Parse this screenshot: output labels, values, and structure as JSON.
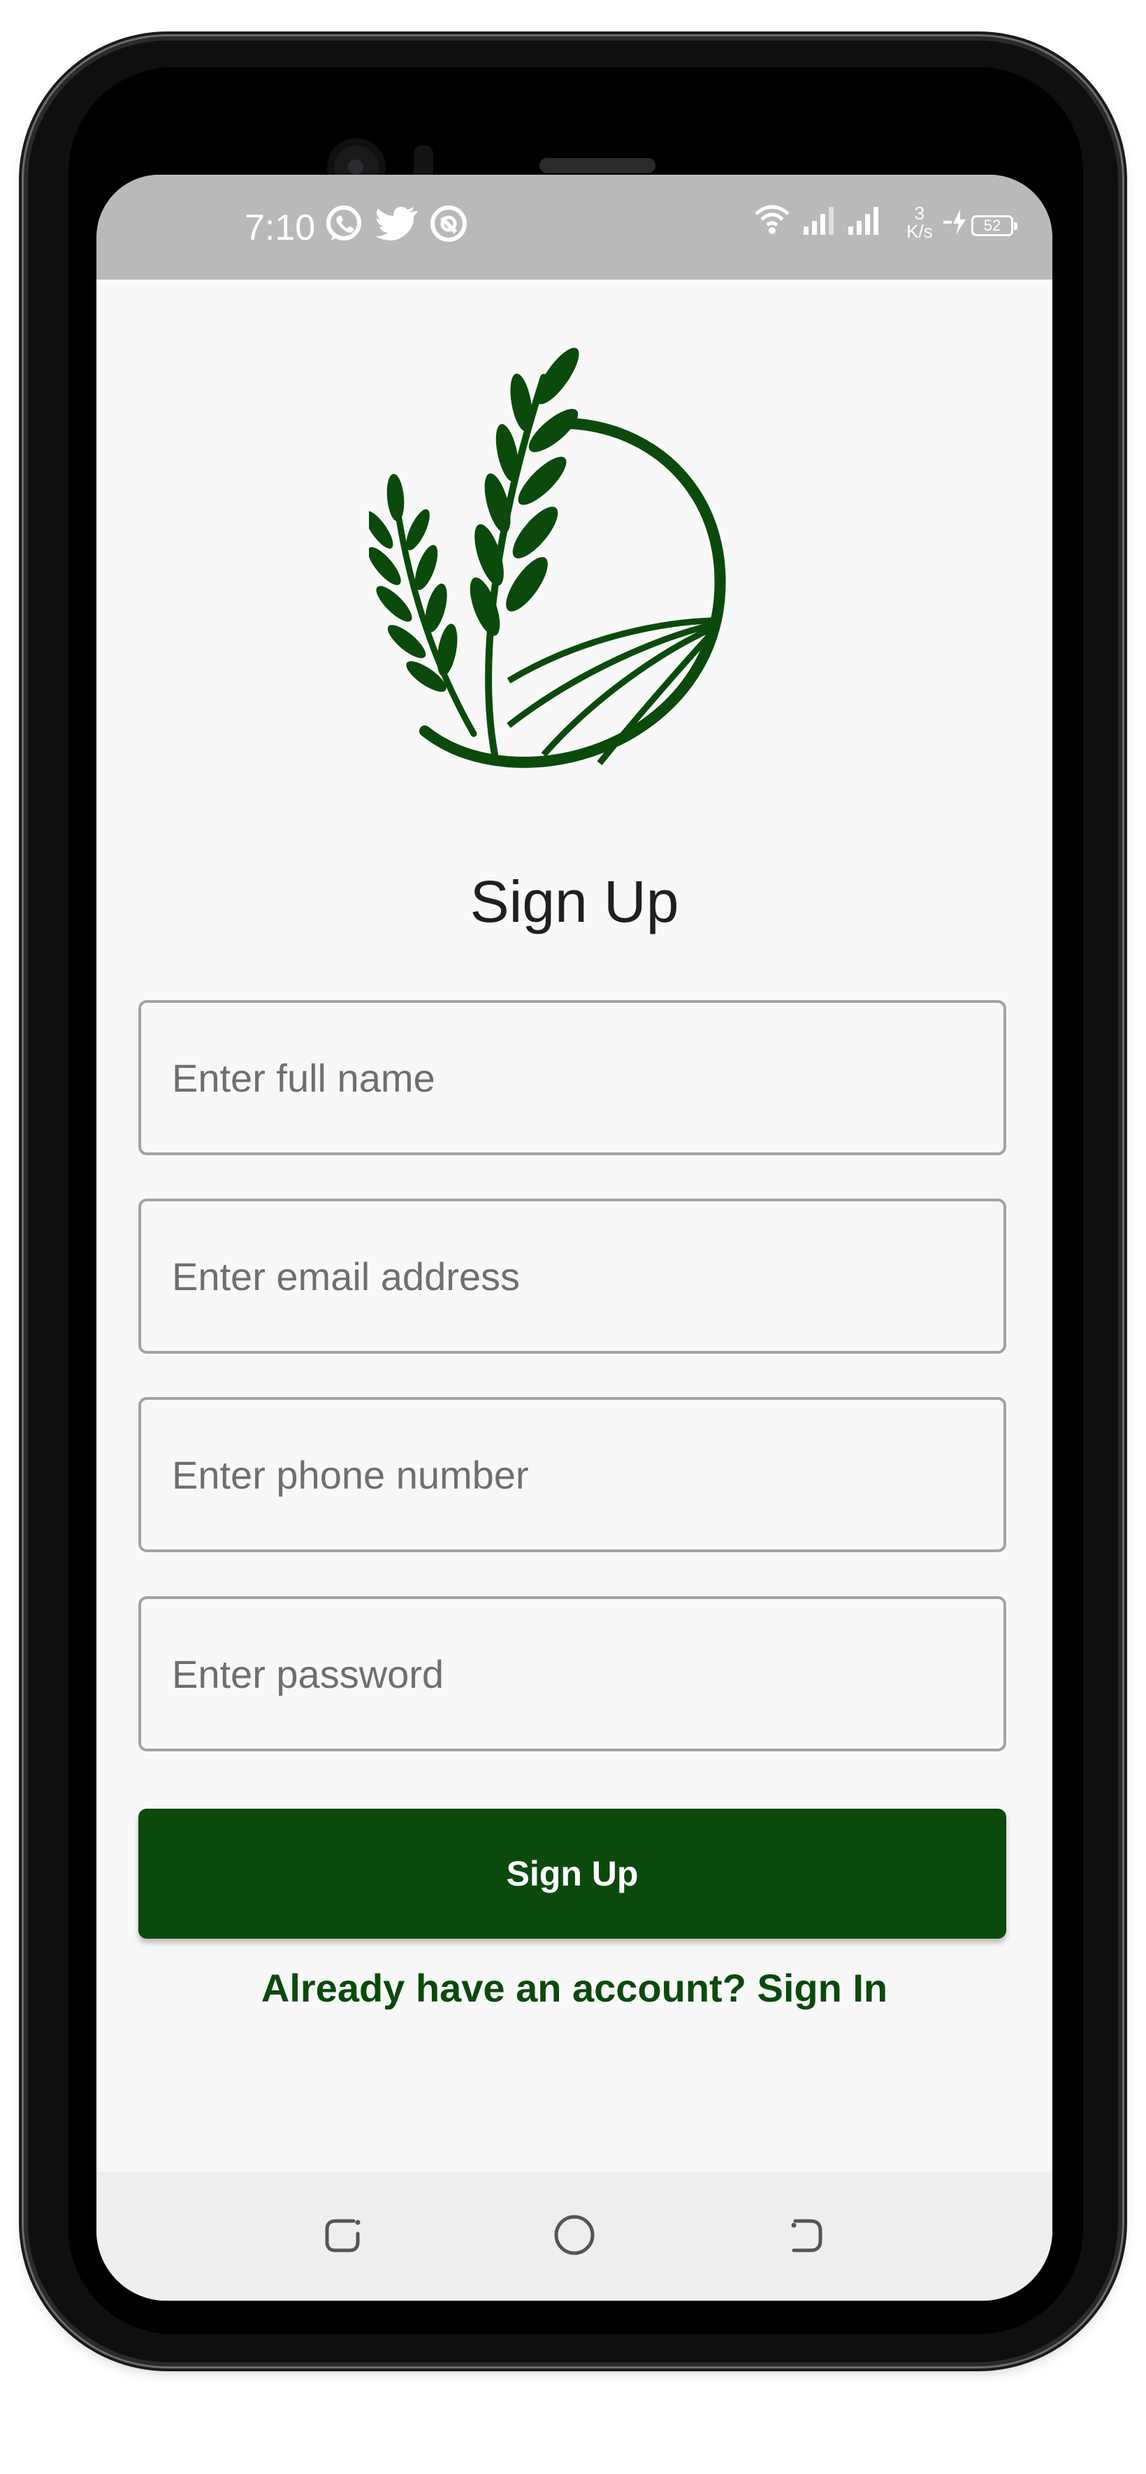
{
  "status_bar": {
    "time": "7:10",
    "notification_icons": [
      "whatsapp-icon",
      "twitter-icon",
      "alert-icon"
    ],
    "network_speed_value": "3",
    "network_speed_unit": "K/s",
    "battery_level": "52"
  },
  "signup_form": {
    "title": "Sign Up",
    "full_name_placeholder": "Enter full name",
    "email_placeholder": "Enter email address",
    "phone_placeholder": "Enter phone number",
    "password_placeholder": "Enter password",
    "submit_label": "Sign Up",
    "signin_link": "Already have an account? Sign In"
  },
  "colors": {
    "brand_green": "#0b4a0c",
    "status_bar": "#b9b9b9",
    "screen_background": "#f8f8f8",
    "field_border": "#a3a3a3"
  },
  "navigation_bar": {
    "icons": [
      "recents-icon",
      "home-icon",
      "back-icon"
    ]
  }
}
